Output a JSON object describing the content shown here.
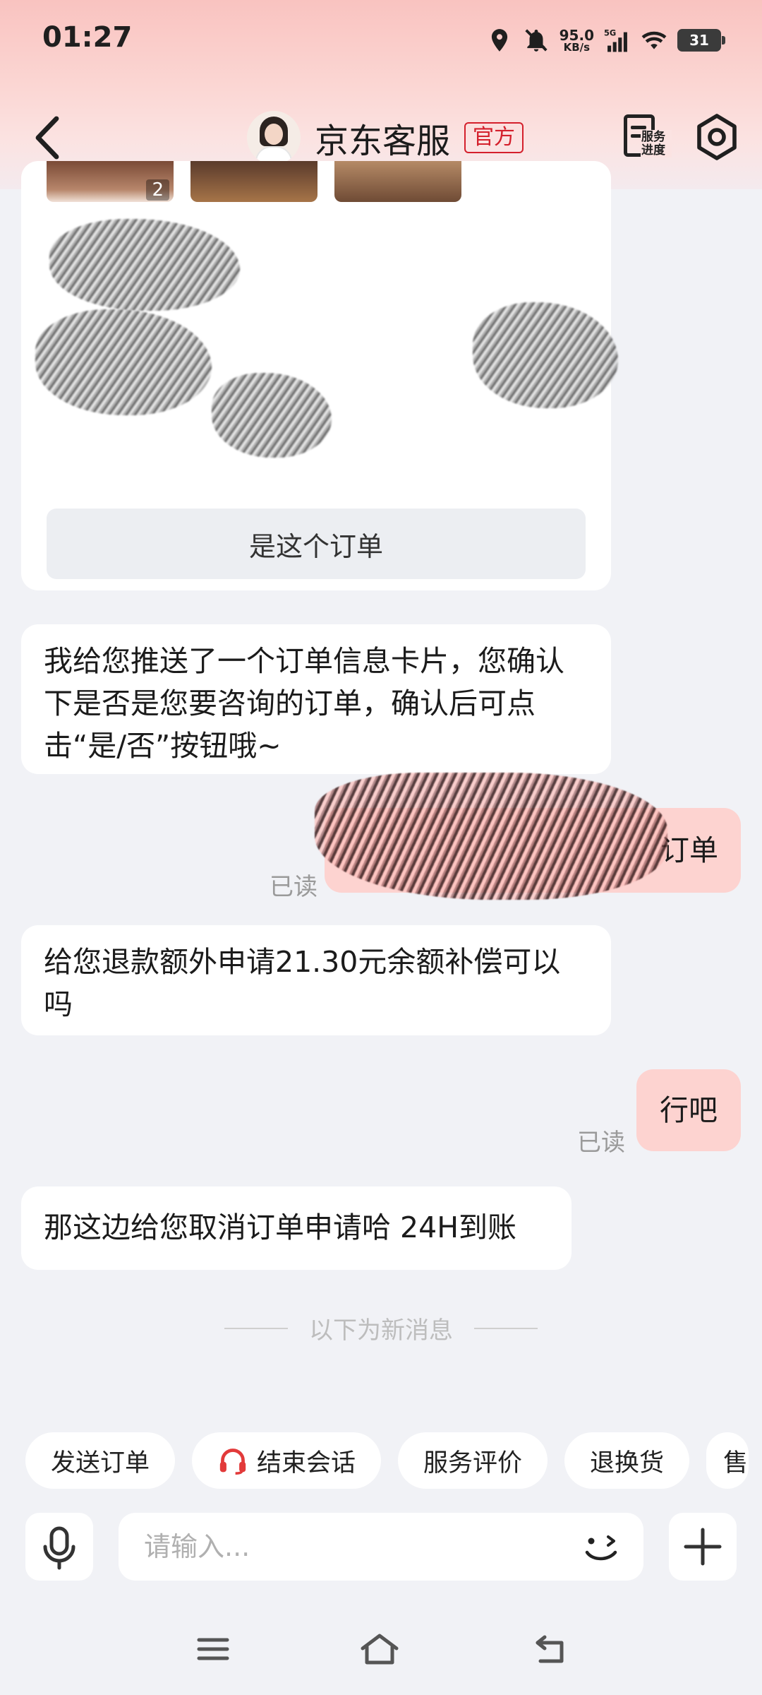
{
  "status_bar": {
    "time": "01:27",
    "net_speed_value": "95.0",
    "net_speed_unit": "KB/s",
    "network": "5G",
    "battery": "31"
  },
  "header": {
    "title": "京东客服",
    "badge": "官方",
    "service_progress_label": "服务进度"
  },
  "order_card": {
    "thumb_count": "2",
    "confirm_button": "是这个订单"
  },
  "messages": [
    {
      "from": "agent",
      "text": "我给您推送了一个订单信息卡片，您确认下是否是您要咨询的订单，确认后可点击“是/否”按钮哦~"
    },
    {
      "from": "me",
      "text": "订单",
      "read": "已读"
    },
    {
      "from": "agent",
      "text": "给您退款额外申请21.30元余额补偿可以吗"
    },
    {
      "from": "me",
      "text": "行吧",
      "read": "已读"
    },
    {
      "from": "agent",
      "text": "那这边给您取消订单申请哈 24H到账"
    }
  ],
  "divider": "以下为新消息",
  "quick_actions": [
    "发送订单",
    "结束会话",
    "服务评价",
    "退换货",
    "售"
  ],
  "input": {
    "placeholder": "请输入..."
  },
  "colors": {
    "brand_red": "#d4202c",
    "my_bubble": "#fdd3d0",
    "background": "#f1f2f6"
  }
}
